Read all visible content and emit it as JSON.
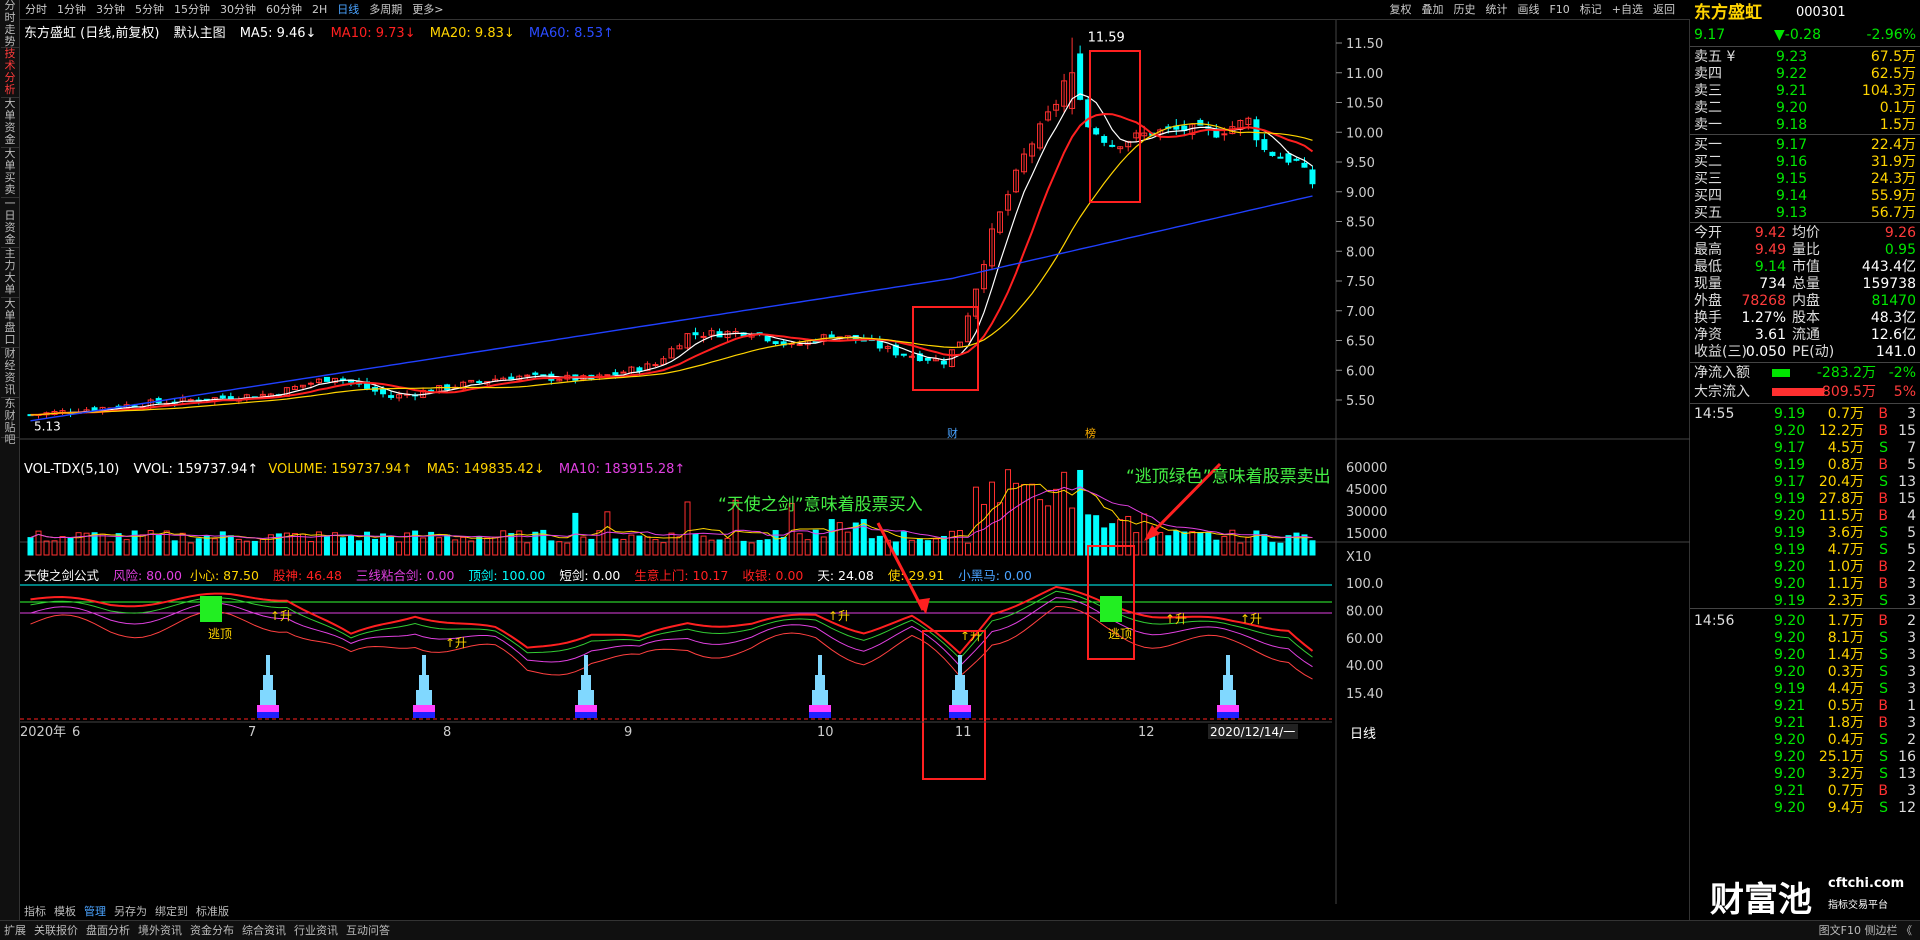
{
  "left_tabs": [
    "分时走势",
    "技术分析",
    "大单资金",
    "大单买卖",
    "一日资金",
    "主力大单",
    "大单盘口",
    "财经资讯",
    "东财贴吧"
  ],
  "period_tabs": [
    "分时",
    "1分钟",
    "3分钟",
    "5分钟",
    "15分钟",
    "30分钟",
    "60分钟",
    "2H",
    "日线",
    "多周期",
    "更多>"
  ],
  "active_period": "日线",
  "top_right_buttons": [
    "复权",
    "叠加",
    "历史",
    "统计",
    "画线",
    "F10",
    "标记",
    "+自选",
    "返回"
  ],
  "main_header": {
    "name": "东方盛虹 (日线,前复权)",
    "template": "默认主图",
    "ma5": "MA5: 9.46↓",
    "ma10": "MA10: 9.73↓",
    "ma20": "MA20: 9.83↓",
    "ma60": "MA60: 8.53↑"
  },
  "price_axis": [
    "11.50",
    "11.00",
    "10.50",
    "10.00",
    "9.50",
    "9.00",
    "8.50",
    "8.00",
    "7.50",
    "7.00",
    "6.50",
    "6.00",
    "5.50"
  ],
  "high_marker": "11.59",
  "low_marker": "5.13",
  "event_labels": {
    "cai": "财",
    "bang": "榜"
  },
  "vol_header": {
    "name": "VOL-TDX(5,10)",
    "vvol": "VVOL: 159737.94↑",
    "volume": "VOLUME: 159737.94↑",
    "ma5": "MA5: 149835.42↓",
    "ma10": "MA10: 183915.28↑"
  },
  "vol_axis": [
    "60000",
    "45000",
    "30000",
    "15000",
    "X10"
  ],
  "ind_header": {
    "name": "天使之剑公式",
    "fx": "风险: 80.00",
    "xx": "小心: 87.50",
    "gs": "股神: 46.48",
    "sx": "三线粘合剑: 0.00",
    "dj": "顶剑: 100.00",
    "dd": "短剑: 0.00",
    "sy": "生意上门: 10.17",
    "sy2": "收银: 0.00",
    "tian": "天: 24.08",
    "shi": "使: 29.91",
    "xhm": "小黑马: 0.00"
  },
  "ind_axis": [
    "100.0",
    "80.00",
    "60.00",
    "40.00",
    "15.40"
  ],
  "signals": {
    "escape": "逃顶",
    "up": "↑升"
  },
  "annotations": {
    "buy": "“天使之剑”意味着股票买入",
    "sell": "“逃顶绿色”意味着股票卖出"
  },
  "date_axis": [
    "2020年",
    "6",
    "7",
    "8",
    "9",
    "10",
    "11",
    "12"
  ],
  "date_current": "2020/12/14/一",
  "foot_tabs": [
    "指标",
    "模板",
    "管理",
    "另存为",
    "绑定到",
    "标准版"
  ],
  "period_label": "日线",
  "quote": {
    "name": "东方盛虹",
    "code": "000301",
    "price": "9.17",
    "change": "▼-0.28",
    "pct": "-2.96%",
    "asks": [
      {
        "label": "卖五 ¥",
        "price": "9.23",
        "vol": "67.5万"
      },
      {
        "label": "卖四",
        "price": "9.22",
        "vol": "62.5万"
      },
      {
        "label": "卖三",
        "price": "9.21",
        "vol": "104.3万"
      },
      {
        "label": "卖二",
        "price": "9.20",
        "vol": "0.1万"
      },
      {
        "label": "卖一",
        "price": "9.18",
        "vol": "1.5万"
      }
    ],
    "bids": [
      {
        "label": "买一",
        "price": "9.17",
        "vol": "22.4万"
      },
      {
        "label": "买二",
        "price": "9.16",
        "vol": "31.9万"
      },
      {
        "label": "买三",
        "price": "9.15",
        "vol": "24.3万"
      },
      {
        "label": "买四",
        "price": "9.14",
        "vol": "55.9万"
      },
      {
        "label": "买五",
        "price": "9.13",
        "vol": "56.7万"
      }
    ],
    "stats": [
      {
        "l1": "今开",
        "v1": "9.42",
        "c1": "red",
        "l2": "均价",
        "v2": "9.26",
        "c2": "red"
      },
      {
        "l1": "最高",
        "v1": "9.49",
        "c1": "red",
        "l2": "量比",
        "v2": "0.95",
        "c2": "green"
      },
      {
        "l1": "最低",
        "v1": "9.14",
        "c1": "green",
        "l2": "市值",
        "v2": "443.4亿",
        "c2": "white"
      },
      {
        "l1": "现量",
        "v1": "734",
        "c1": "white",
        "l2": "总量",
        "v2": "159738",
        "c2": "white"
      },
      {
        "l1": "外盘",
        "v1": "78268",
        "c1": "red",
        "l2": "内盘",
        "v2": "81470",
        "c2": "green"
      },
      {
        "l1": "换手",
        "v1": "1.27%",
        "c1": "white",
        "l2": "股本",
        "v2": "48.3亿",
        "c2": "white"
      },
      {
        "l1": "净资",
        "v1": "3.61",
        "c1": "white",
        "l2": "流通",
        "v2": "12.6亿",
        "c2": "white"
      },
      {
        "l1": "收益(三)",
        "v1": "0.050",
        "c1": "white",
        "l2": "PE(动)",
        "v2": "141.0",
        "c2": "white"
      }
    ],
    "flows": [
      {
        "label": "净流入额",
        "val": "-283.2万",
        "pct": "-2%",
        "color": "green"
      },
      {
        "label": "大宗流入",
        "val": "809.5万",
        "pct": "5%",
        "color": "red"
      }
    ],
    "ticks": [
      {
        "time": "14:55",
        "price": "9.19",
        "vol": "0.7万",
        "bs": "B",
        "n": "3"
      },
      {
        "time": "",
        "price": "9.20",
        "vol": "12.2万",
        "bs": "B",
        "n": "15"
      },
      {
        "time": "",
        "price": "9.17",
        "vol": "4.5万",
        "bs": "S",
        "n": "7"
      },
      {
        "time": "",
        "price": "9.19",
        "vol": "0.8万",
        "bs": "B",
        "n": "5"
      },
      {
        "time": "",
        "price": "9.17",
        "vol": "20.4万",
        "bs": "S",
        "n": "13"
      },
      {
        "time": "",
        "price": "9.19",
        "vol": "27.8万",
        "bs": "B",
        "n": "15"
      },
      {
        "time": "",
        "price": "9.20",
        "vol": "11.5万",
        "bs": "B",
        "n": "4"
      },
      {
        "time": "",
        "price": "9.19",
        "vol": "3.6万",
        "bs": "S",
        "n": "5"
      },
      {
        "time": "",
        "price": "9.19",
        "vol": "4.7万",
        "bs": "S",
        "n": "5"
      },
      {
        "time": "",
        "price": "9.20",
        "vol": "1.0万",
        "bs": "B",
        "n": "2"
      },
      {
        "time": "",
        "price": "9.20",
        "vol": "1.1万",
        "bs": "B",
        "n": "3"
      },
      {
        "time": "",
        "price": "9.19",
        "vol": "2.3万",
        "bs": "S",
        "n": "3"
      },
      {
        "time": "14:56",
        "price": "9.20",
        "vol": "1.7万",
        "bs": "B",
        "n": "2"
      },
      {
        "time": "",
        "price": "9.20",
        "vol": "8.1万",
        "bs": "S",
        "n": "3"
      },
      {
        "time": "",
        "price": "9.20",
        "vol": "1.4万",
        "bs": "S",
        "n": "3"
      },
      {
        "time": "",
        "price": "9.20",
        "vol": "0.3万",
        "bs": "S",
        "n": "3"
      },
      {
        "time": "",
        "price": "9.19",
        "vol": "4.4万",
        "bs": "S",
        "n": "3"
      },
      {
        "time": "",
        "price": "9.21",
        "vol": "0.5万",
        "bs": "B",
        "n": "1"
      },
      {
        "time": "",
        "price": "9.21",
        "vol": "1.8万",
        "bs": "B",
        "n": "3"
      },
      {
        "time": "",
        "price": "9.20",
        "vol": "0.4万",
        "bs": "S",
        "n": "2"
      },
      {
        "time": "",
        "price": "9.20",
        "vol": "25.1万",
        "bs": "S",
        "n": "16"
      },
      {
        "time": "",
        "price": "9.20",
        "vol": "3.2万",
        "bs": "S",
        "n": "13"
      },
      {
        "time": "",
        "price": "9.21",
        "vol": "0.7万",
        "bs": "B",
        "n": "3"
      },
      {
        "time": "",
        "price": "9.20",
        "vol": "9.4万",
        "bs": "S",
        "n": "12"
      }
    ]
  },
  "watermark": {
    "main": "财富池",
    "site": "cftchi.com",
    "sub": "指标交易平台"
  },
  "bottom_tabs": [
    "扩展",
    "关联报价",
    "盘面分析",
    "境外资讯",
    "资金分布",
    "综合资讯",
    "行业资讯",
    "互动问答"
  ],
  "bottom_right": "图文F10 侧边栏 《"
}
